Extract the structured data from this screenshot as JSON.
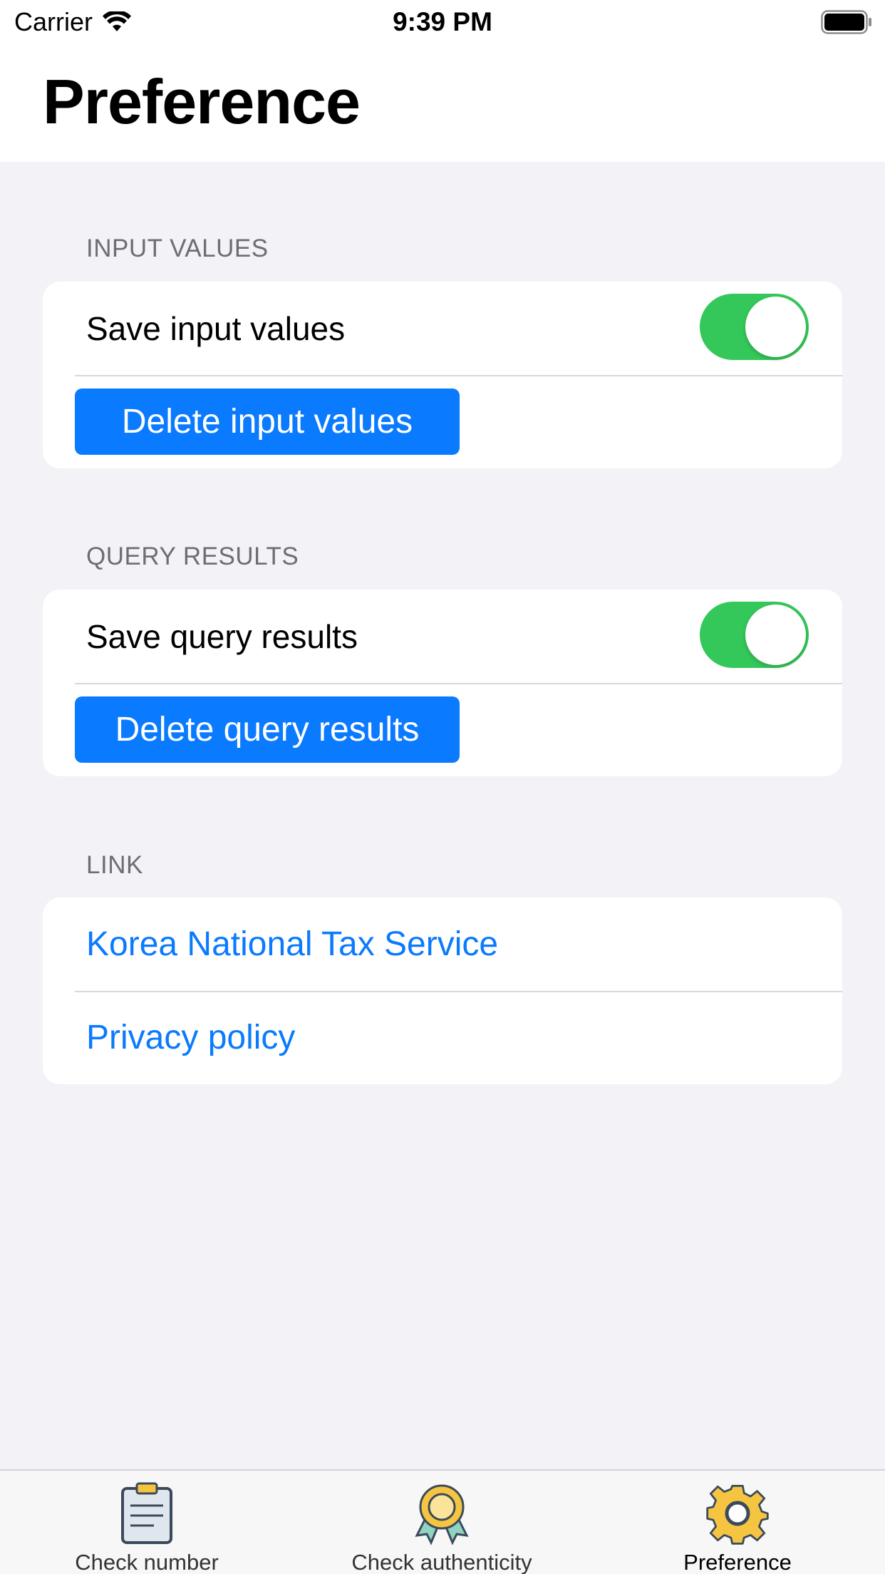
{
  "status_bar": {
    "carrier": "Carrier",
    "time": "9:39 PM"
  },
  "page_title": "Preference",
  "sections": {
    "input_values": {
      "header": "INPUT VALUES",
      "toggle_label": "Save input values",
      "toggle_on": true,
      "button_label": "Delete input values"
    },
    "query_results": {
      "header": "QUERY RESULTS",
      "toggle_label": "Save query results",
      "toggle_on": true,
      "button_label": "Delete query results"
    },
    "link": {
      "header": "LINK",
      "items": [
        {
          "label": "Korea National Tax Service"
        },
        {
          "label": "Privacy policy"
        }
      ]
    }
  },
  "tabbar": {
    "tabs": [
      {
        "label": "Check number",
        "icon": "clipboard-icon"
      },
      {
        "label": "Check authenticity",
        "icon": "award-badge-icon"
      },
      {
        "label": "Preference",
        "icon": "gear-icon"
      }
    ],
    "active": "Preference"
  },
  "colors": {
    "accent": "#0a7aff",
    "toggle_on": "#34c759",
    "background": "#f2f2f7",
    "section_header": "#6d6d72"
  }
}
